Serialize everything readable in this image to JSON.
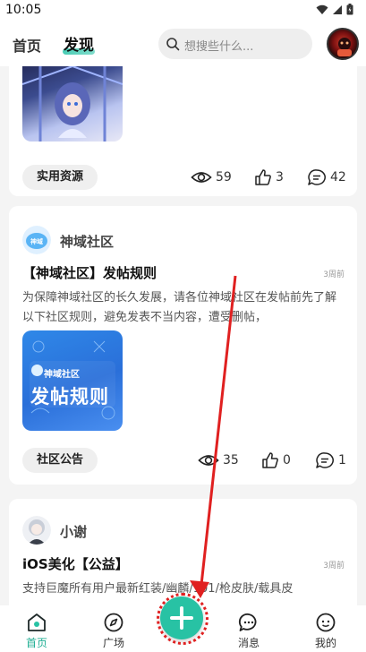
{
  "status_bar": {
    "time": "10:05"
  },
  "header": {
    "tabs": [
      {
        "label": "首页"
      },
      {
        "label": "发现"
      }
    ],
    "search": {
      "placeholder": "想搜些什么..."
    }
  },
  "posts": [
    {
      "tag": "实用资源",
      "views": "59",
      "likes": "3",
      "comments": "42"
    },
    {
      "author": "神域社区",
      "author_badge": "神域",
      "title": "【神域社区】发帖规则",
      "time": "3周前",
      "body": "为保障神域社区的长久发展，请各位神域社区在发帖前先了解以下社区规则，避免发表不当内容，遭受删帖，",
      "image_brand": "神域社区",
      "image_title": "发帖规则",
      "tag": "社区公告",
      "views": "35",
      "likes": "0",
      "comments": "1"
    },
    {
      "author": "小谢",
      "title": "iOS美化【公益】",
      "time": "3周前",
      "body": "支持巨魔所有用户最新红装/幽麟/101/枪皮肤/载具皮"
    }
  ],
  "bottom_nav": {
    "items": [
      {
        "label": "首页"
      },
      {
        "label": "广场"
      },
      {
        "label": "消息"
      },
      {
        "label": "我的"
      }
    ]
  },
  "colors": {
    "accent": "#28c2a4",
    "annotation": "#e02020"
  },
  "icons": [
    "signal-icon",
    "battery-icon",
    "search-icon",
    "eye-icon",
    "thumbs-up-icon",
    "comment-icon",
    "home-icon",
    "compass-icon",
    "plus-icon",
    "message-icon",
    "profile-icon"
  ]
}
